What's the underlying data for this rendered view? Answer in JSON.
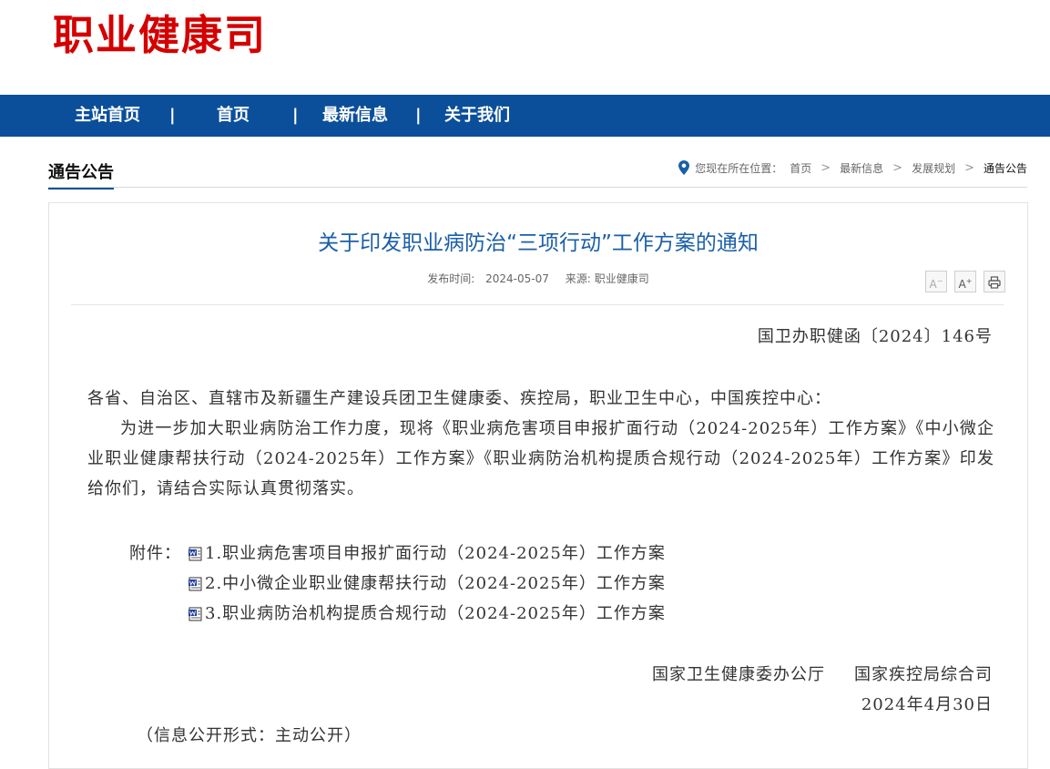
{
  "header": {
    "site_title": "职业健康司"
  },
  "nav": {
    "items": [
      {
        "label": "主站首页"
      },
      {
        "label": "首页"
      },
      {
        "label": "最新信息"
      },
      {
        "label": "关于我们"
      }
    ],
    "separator": "|"
  },
  "section": {
    "title": "通告公告"
  },
  "breadcrumb": {
    "prefix": "您现在所在位置：",
    "items": [
      "首页",
      "最新信息",
      "发展规划",
      "通告公告"
    ],
    "separator": ">"
  },
  "article": {
    "title": "关于印发职业病防治“三项行动”工作方案的通知",
    "publish_label": "发布时间:",
    "publish_date": "2024-05-07",
    "source_label": "来源:",
    "source": "职业健康司",
    "tools": {
      "font_smaller": "A",
      "font_larger": "A",
      "print": "print"
    },
    "doc_number": "国卫办职健函〔2024〕146号",
    "addressee": "各省、自治区、直辖市及新疆生产建设兵团卫生健康委、疾控局，职业卫生中心，中国疾控中心：",
    "body": "为进一步加大职业病防治工作力度，现将《职业病危害项目申报扩面行动（2024-2025年）工作方案》《中小微企业职业健康帮扶行动（2024-2025年）工作方案》《职业病防治机构提质合规行动（2024-2025年）工作方案》印发给你们，请结合实际认真贯彻落实。",
    "attachments_label": "附件：",
    "attachments": [
      {
        "label": "1.职业病危害项目申报扩面行动（2024-2025年）工作方案"
      },
      {
        "label": "2.中小微企业职业健康帮扶行动（2024-2025年）工作方案"
      },
      {
        "label": "3.职业病防治机构提质合规行动（2024-2025年）工作方案"
      }
    ],
    "signer_1": "国家卫生健康委办公厅",
    "signer_2": "国家疾控局综合司",
    "date": "2024年4月30日",
    "disclosure": "（信息公开形式：主动公开）"
  },
  "colors": {
    "brand_red": "#d40000",
    "nav_blue": "#0b4f9a",
    "title_blue": "#1a5fa8"
  }
}
